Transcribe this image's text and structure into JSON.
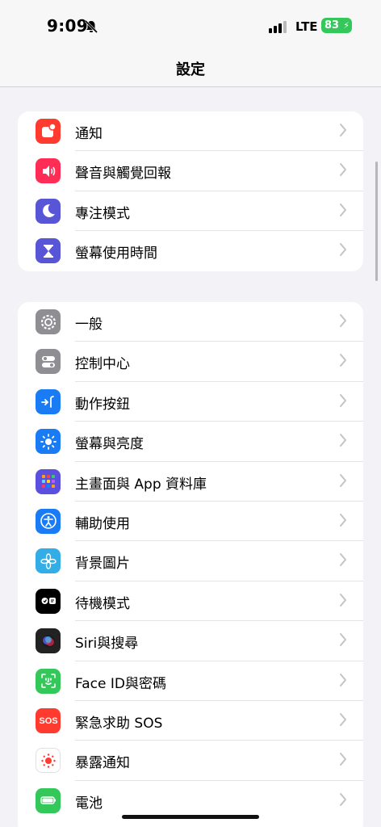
{
  "status": {
    "time": "9:09",
    "network": "LTE",
    "battery": "83"
  },
  "nav": {
    "title": "設定"
  },
  "group1": [
    {
      "label": "通知",
      "icon": "notifications-icon",
      "color": "#ff3b30"
    },
    {
      "label": "聲音與觸覺回報",
      "icon": "sound-icon",
      "color": "#ff2d55"
    },
    {
      "label": "專注模式",
      "icon": "moon-icon",
      "color": "#5856d6"
    },
    {
      "label": "螢幕使用時間",
      "icon": "hourglass-icon",
      "color": "#5856d6"
    }
  ],
  "group2": [
    {
      "label": "一般",
      "icon": "gear-icon",
      "color": "#8e8e93"
    },
    {
      "label": "控制中心",
      "icon": "toggles-icon",
      "color": "#8e8e93"
    },
    {
      "label": "動作按鈕",
      "icon": "action-button-icon",
      "color": "#1a7cf5"
    },
    {
      "label": "螢幕與亮度",
      "icon": "brightness-icon",
      "color": "#1a7cf5"
    },
    {
      "label": "主畫面與 App 資料庫",
      "icon": "home-screen-icon",
      "color": "#5b4fe0"
    },
    {
      "label": "輔助使用",
      "icon": "accessibility-icon",
      "color": "#1a7cf5"
    },
    {
      "label": "背景圖片",
      "icon": "wallpaper-icon",
      "color": "#32ade6"
    },
    {
      "label": "待機模式",
      "icon": "standby-icon",
      "color": "#000000"
    },
    {
      "label": "Siri與搜尋",
      "icon": "siri-icon",
      "color": "#222222"
    },
    {
      "label": "Face ID與密碼",
      "icon": "face-id-icon",
      "color": "#34c759"
    },
    {
      "label": "緊急求助 SOS",
      "icon": "sos-icon",
      "color": "#ff3b30"
    },
    {
      "label": "暴露通知",
      "icon": "exposure-icon",
      "color": "#ffffff"
    },
    {
      "label": "電池",
      "icon": "battery-icon",
      "color": "#34c759"
    }
  ]
}
